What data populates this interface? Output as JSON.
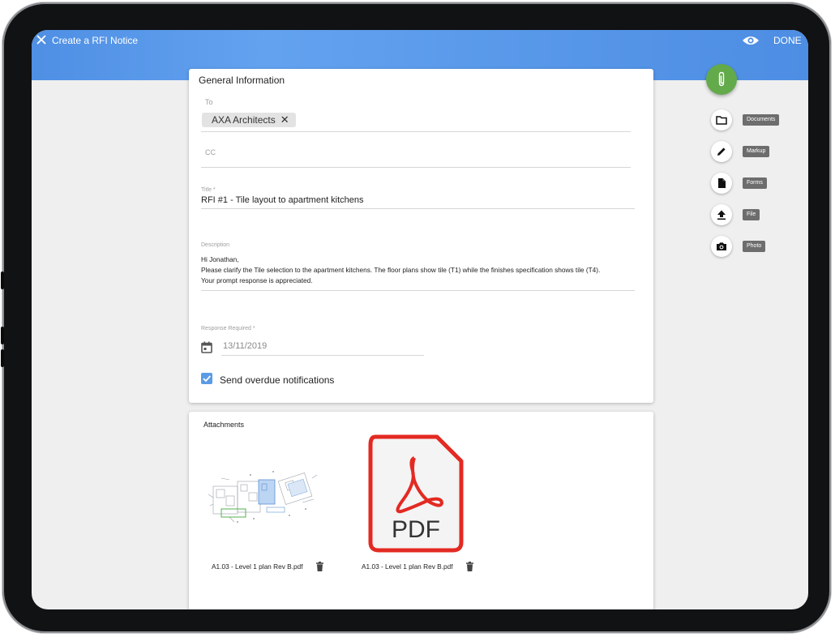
{
  "header": {
    "title": "Create a RFI Notice",
    "done_label": "DONE"
  },
  "general": {
    "heading": "General Information",
    "to_label": "To",
    "to_chip": "AXA Architects",
    "cc_label": "CC",
    "title_label": "Title *",
    "title_value": "RFI #1 - Tile layout to apartment kitchens",
    "description_label": "Description",
    "description_lines": [
      "Hi Jonathan,",
      "Please clarify the Tile selection to the apartment kitchens. The floor plans show tile (T1) while the finishes specification shows tile (T4).",
      "Your prompt response is appreciated."
    ],
    "response_label": "Response Required *",
    "response_date": "13/11/2019",
    "overdue_label": "Send overdue notifications",
    "overdue_checked": true
  },
  "attachments": {
    "heading": "Attachments",
    "items": [
      {
        "name": "A1.03  - Level 1 plan Rev B.pdf",
        "type": "drawing-thumbnail"
      },
      {
        "name": "A1.03  - Level 1 plan Rev B.pdf",
        "type": "pdf-icon",
        "badge": "PDF"
      }
    ]
  },
  "actions": {
    "fab_icon": "paperclip-icon",
    "items": [
      {
        "label": "Documents",
        "icon": "folder-icon"
      },
      {
        "label": "Markup",
        "icon": "pencil-icon"
      },
      {
        "label": "Forms",
        "icon": "file-icon"
      },
      {
        "label": "File",
        "icon": "upload-icon"
      },
      {
        "label": "Photo",
        "icon": "camera-icon"
      }
    ]
  },
  "colors": {
    "header": "#4f8fe4",
    "fab": "#63aa4a",
    "checkbox": "#5b9be6",
    "pdf_red": "#e32a22"
  }
}
